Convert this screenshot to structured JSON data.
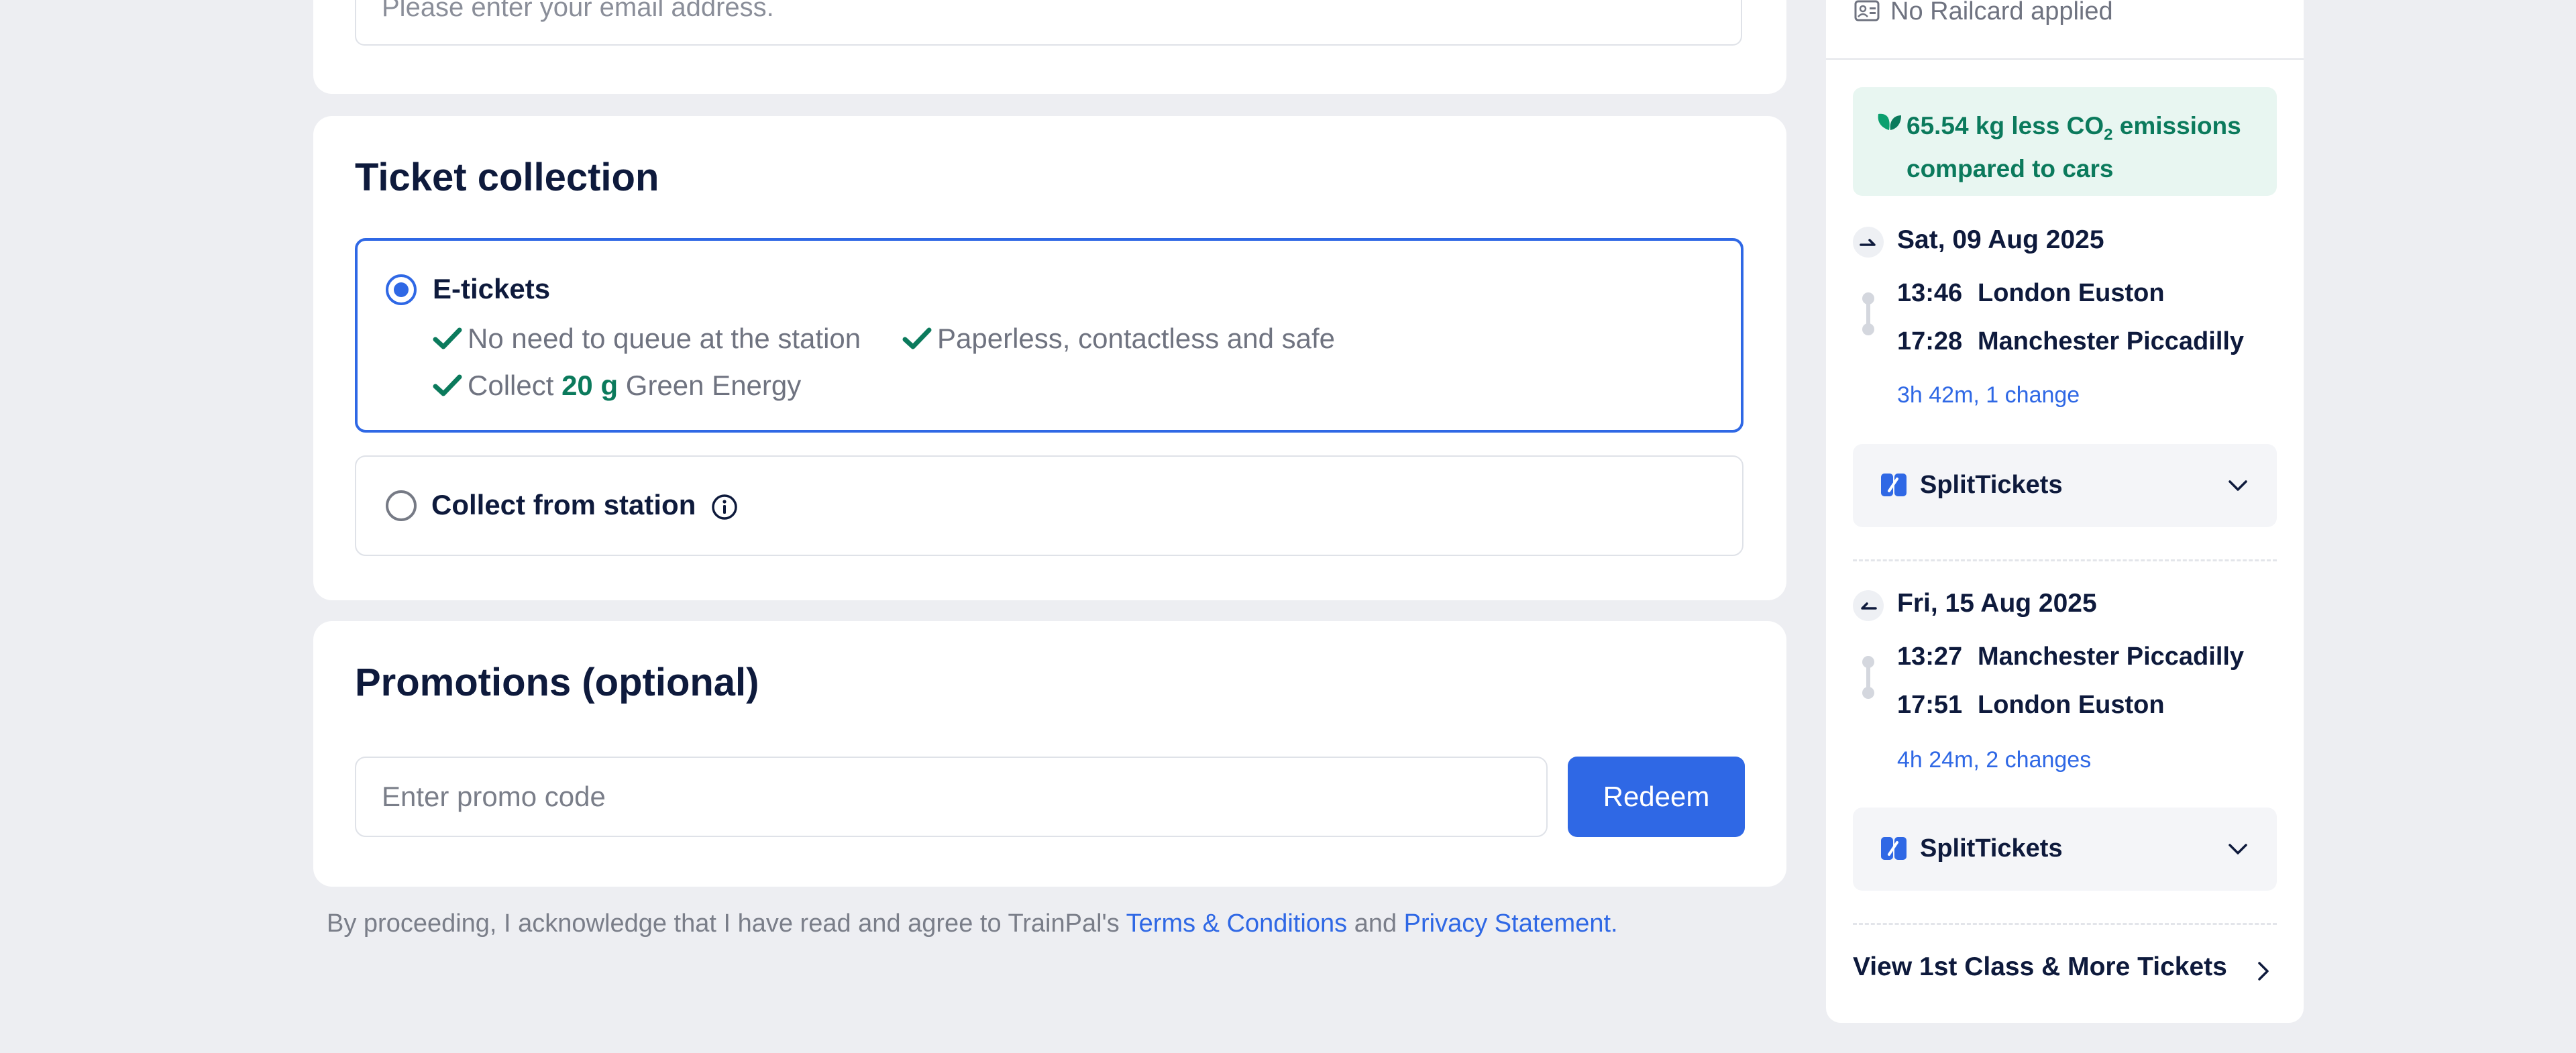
{
  "email": {
    "placeholder": "Please enter your email address."
  },
  "ticket_collection": {
    "title": "Ticket collection",
    "options": [
      {
        "label": "E-tickets",
        "selected": true,
        "features": [
          "No need to queue at the station",
          "Paperless, contactless and safe"
        ],
        "green_prefix": "Collect",
        "green_amount": "20 g",
        "green_suffix": "Green Energy"
      },
      {
        "label": "Collect from station",
        "selected": false
      }
    ]
  },
  "promotions": {
    "title": "Promotions (optional)",
    "input_placeholder": "Enter promo code",
    "redeem_label": "Redeem"
  },
  "legal": {
    "prefix": "By proceeding, I acknowledge that I have read and agree to TrainPal's",
    "terms_link": "Terms & Conditions",
    "and": "and",
    "privacy_link": "Privacy Statement."
  },
  "sidebar": {
    "railcard": "No Railcard applied",
    "co2": {
      "text_before": "65.54 kg less CO",
      "subscript": "2",
      "text_after": " emissions compared to cars"
    },
    "journeys": [
      {
        "direction": "outbound",
        "date": "Sat, 09 Aug 2025",
        "departure_time": "13:46",
        "departure_station": "London Euston",
        "arrival_time": "17:28",
        "arrival_station": "Manchester Piccadilly",
        "duration": "3h 42m, 1 change",
        "ticket_type": "SplitTickets"
      },
      {
        "direction": "return",
        "date": "Fri, 15 Aug 2025",
        "departure_time": "13:27",
        "departure_station": "Manchester Piccadilly",
        "arrival_time": "17:51",
        "arrival_station": "London Euston",
        "duration": "4h 24m, 2 changes",
        "ticket_type": "SplitTickets"
      }
    ],
    "view_more": "View 1st Class & More Tickets"
  },
  "colors": {
    "accent": "#2f68e5",
    "green": "#0b7a5c",
    "co2_bg": "#e8f6f1",
    "page_bg": "#edeef2",
    "text_dark": "#0e1a3c"
  }
}
